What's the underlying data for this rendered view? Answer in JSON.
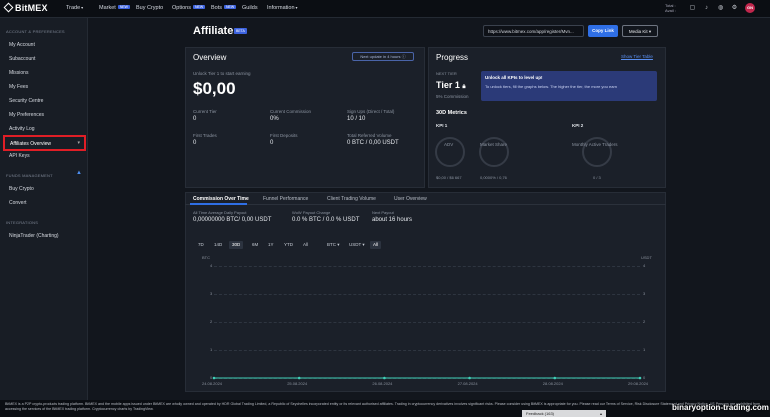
{
  "app": {
    "logo": "BitMEX"
  },
  "topnav": {
    "items": [
      {
        "label": "Trade",
        "caret": true,
        "new": false
      },
      {
        "label": "Market",
        "caret": false,
        "new": true
      },
      {
        "label": "Buy Crypto",
        "caret": false,
        "new": false
      },
      {
        "label": "Options",
        "caret": false,
        "new": true
      },
      {
        "label": "Bots",
        "caret": false,
        "new": true
      },
      {
        "label": "Guilds",
        "caret": false,
        "new": false
      },
      {
        "label": "Information",
        "caret": true,
        "new": false
      }
    ],
    "new_badge": "NEW",
    "total_label": "Total :",
    "avail_label": "Avail :",
    "avatar": "GN"
  },
  "sidebar": {
    "section_account": "ACCOUNT & PREFERENCES",
    "account_items": [
      "My Account",
      "Subaccount",
      "Missions",
      "My Fees",
      "Security Centre",
      "My Preferences",
      "Activity Log"
    ],
    "active_item": "Affiliates Overview",
    "api_keys": "API Keys",
    "section_funds": "FUNDS MANAGEMENT",
    "funds_items": [
      "Buy Crypto",
      "Convert"
    ],
    "section_integrations": "INTEGRATIONS",
    "integration_items": [
      "NinjaTrader (Charting)"
    ]
  },
  "header": {
    "title": "Affiliates",
    "beta": "BETA",
    "referral_link": "https://www.bitmex.com/app/register/Mvn...",
    "copy_link": "Copy Link",
    "media_kit": "Media Kit"
  },
  "overview": {
    "title": "Overview",
    "next_update": "Next update in 4 hours",
    "unlock_text": "Unlock Tier 1 to start earning",
    "big_value": "$0,00",
    "stats": [
      {
        "label": "Current Tier",
        "value": "0"
      },
      {
        "label": "Current Commission",
        "value": "0%"
      },
      {
        "label": "Sign Ups (Direct / Total)",
        "value": "10 / 10"
      },
      {
        "label": "First Trades",
        "value": "0"
      },
      {
        "label": "First Deposits",
        "value": "0"
      },
      {
        "label": "Total Referred Volume",
        "value": "0 BTC / 0,00 USDT"
      }
    ]
  },
  "progress": {
    "title": "Progress",
    "tier_table": "Show Tier Table",
    "next_tier_label": "NEXT TIER",
    "next_tier": "Tier 1",
    "commission": "5% Commission",
    "unlock_title": "Unlock all KPIs to level up!",
    "unlock_body": "To unlock tiers, fill the graphs below. The higher the tier, the more you earn",
    "metrics_title": "30D Metrics",
    "kpi1": "KPI 1",
    "kpi2": "KPI 2",
    "adv_label": "ADV",
    "adv_value": "$0,00 / $6 667",
    "share_label": "Market Share",
    "share_value": "0,0000% / 0,76",
    "traders_label": "Monthly Active Traders",
    "traders_value": "0 / 3"
  },
  "bottom": {
    "tabs": [
      "Commission Over Time",
      "Funnel Performance",
      "Client Trading Volume",
      "User Overview"
    ],
    "stats": [
      {
        "label": "All Time Average Daily Payout",
        "value": "0,00000000 BTC/ 0,00 USDT"
      },
      {
        "label": "WoW Payout Change",
        "value": "0.0 % BTC / 0.0 % USDT"
      },
      {
        "label": "Next Payout",
        "value": "about 16 hours"
      }
    ],
    "ranges": [
      "7D",
      "14D",
      "30D",
      "6M",
      "1Y",
      "YTD",
      "All"
    ],
    "selected_range": "30D",
    "btc_select": "BTC",
    "usdt_select": "USDT",
    "all_select": "All"
  },
  "chart_data": {
    "type": "line",
    "y_left_label": "BTC",
    "y_right_label": "USDT",
    "y_ticks": [
      "4",
      "3",
      "2",
      "1",
      "0"
    ],
    "ylim": [
      0,
      4
    ],
    "x": [
      "24.08.2024",
      "25.08.2024",
      "26.08.2024",
      "27.08.2024",
      "28.08.2024",
      "29.08.2024"
    ],
    "series": [
      {
        "values": [
          0,
          0,
          0,
          0,
          0,
          0
        ]
      }
    ],
    "line_color": "#3fd0b8"
  },
  "footer": {
    "text": "BitMEX is a P2P crypto-products trading platform. BitMEX and the mobile apps issued under BitMEX are wholly owned and operated by HDR Global Trading Limited, a Republic of Seychelles incorporated entity or its relevant authorised affiliates. Trading in cryptocurrency derivatives involves significant risks. Please consider using BitMEX is appropriate for you. Please read our Terms of Service, Risk Disclosure Statement and Privacy Notice. US Persons are prohibited from accessing the services of the BitMEX trading platform. Cryptocurrency charts by TradingView.",
    "feedback": "Feedback (163)",
    "watermark": "binaryoption-trading.com"
  }
}
